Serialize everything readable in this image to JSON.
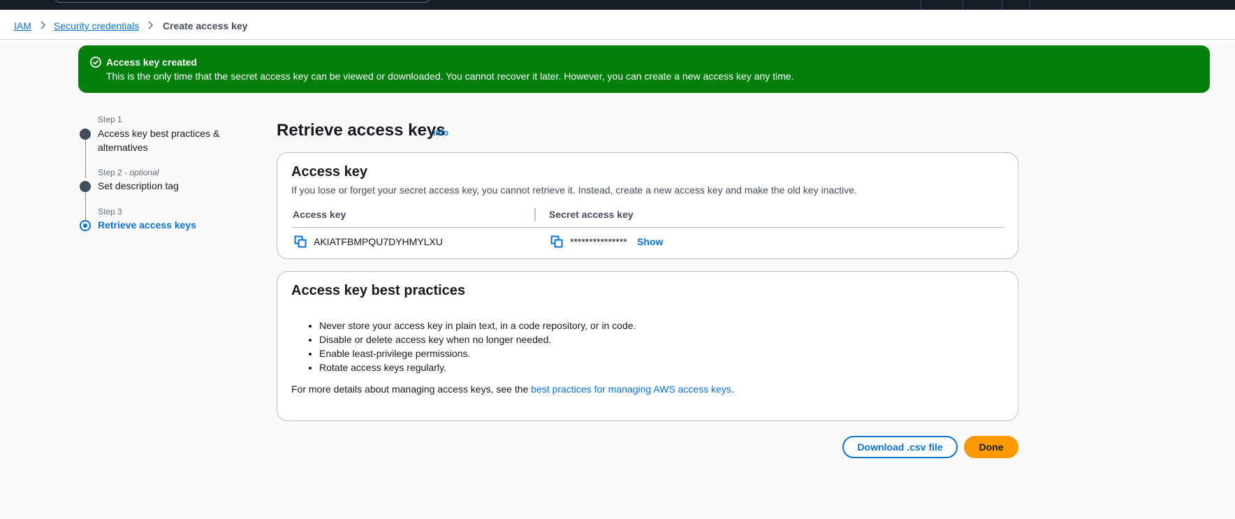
{
  "breadcrumbs": {
    "items": [
      "IAM",
      "Security credentials"
    ],
    "current": "Create access key"
  },
  "flash": {
    "title": "Access key created",
    "message": "This is the only time that the secret access key can be viewed or downloaded. You cannot recover it later. However, you can create a new access key any time.",
    "color": "#037f0c"
  },
  "steps": [
    {
      "small": "Step 1",
      "optional": "",
      "label": "Access key best practices & alternatives"
    },
    {
      "small": "Step 2",
      "optional": "optional",
      "label": "Set description tag"
    },
    {
      "small": "Step 3",
      "optional": "",
      "label": "Retrieve access keys"
    }
  ],
  "page": {
    "title": "Retrieve access keys",
    "info": "Info"
  },
  "access_key_card": {
    "title": "Access key",
    "description": "If you lose or forget your secret access key, you cannot retrieve it. Instead, create a new access key and make the old key inactive.",
    "col_access_key": "Access key",
    "col_secret_key": "Secret access key",
    "access_key_value": "AKIATFBMPQU7DYHMYLXU",
    "secret_masked": "***************",
    "show_label": "Show"
  },
  "best_practices_card": {
    "title": "Access key best practices",
    "items": [
      "Never store your access key in plain text, in a code repository, or in code.",
      "Disable or delete access key when no longer needed.",
      "Enable least-privilege permissions.",
      "Rotate access keys regularly."
    ],
    "more_prefix": "For more details about managing access keys, see the ",
    "more_link": "best practices for managing AWS access keys",
    "more_suffix": "."
  },
  "actions": {
    "download": "Download .csv file",
    "done": "Done"
  },
  "colors": {
    "link": "#0972d3",
    "primary": "#ff9900",
    "topbar": "#161d26"
  }
}
